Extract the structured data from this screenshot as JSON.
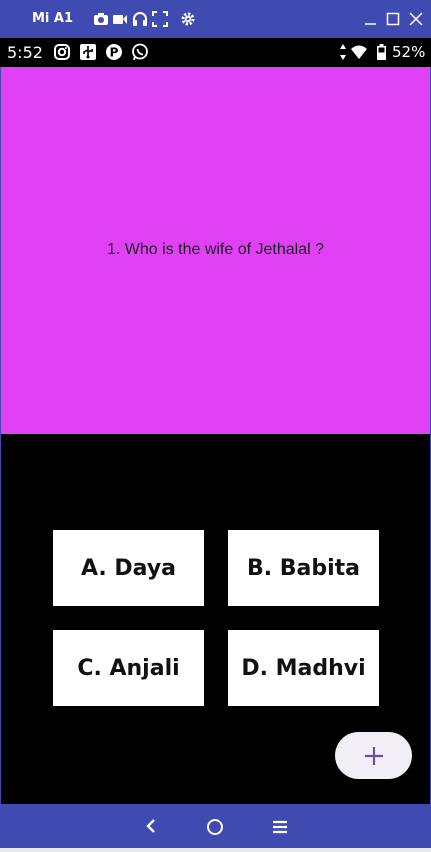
{
  "window": {
    "title": "Mi A1"
  },
  "status_bar": {
    "time": "5:52",
    "battery": "52%"
  },
  "question": {
    "text": "1. Who is the wife of Jethalal ?"
  },
  "answers": [
    {
      "label": "A. Daya"
    },
    {
      "label": "B. Babita"
    },
    {
      "label": "C. Anjali"
    },
    {
      "label": "D. Madhvi"
    }
  ],
  "colors": {
    "question_bg": "#e041f4",
    "answer_bg": "#000000",
    "chrome": "#3f4bb0",
    "fab": "#f2eef6",
    "fab_icon": "#6750a4"
  },
  "icons": {
    "title_bar": [
      "camera-icon",
      "video-icon",
      "headset-icon",
      "fullscreen-icon",
      "settings-icon"
    ],
    "window_controls": [
      "minimize-icon",
      "maximize-icon",
      "close-icon"
    ],
    "status_left": [
      "instagram-icon",
      "usb-icon",
      "paytm-icon",
      "whatsapp-icon"
    ],
    "status_right": [
      "data-arrows-icon",
      "wifi-icon",
      "battery-icon"
    ],
    "fab": "plus-icon",
    "nav": [
      "back-icon",
      "home-icon",
      "recents-icon"
    ]
  }
}
